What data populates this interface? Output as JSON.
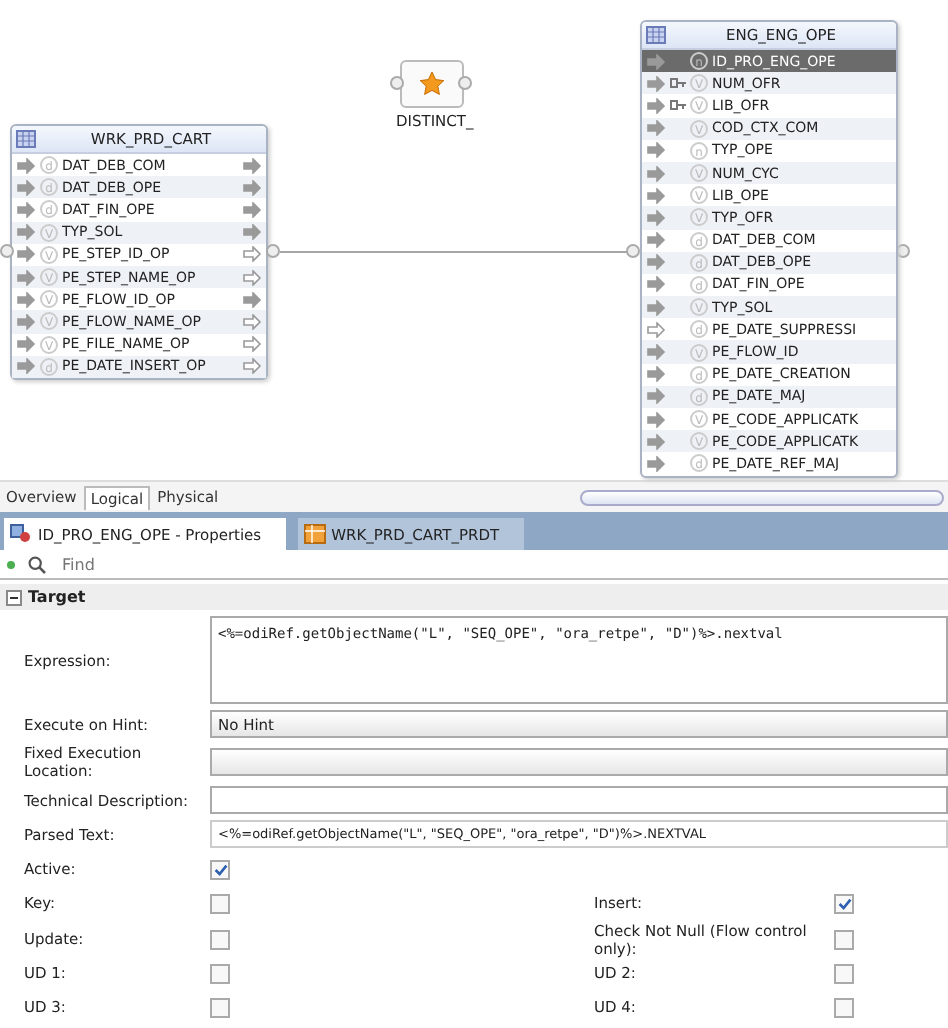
{
  "diagram": {
    "distinct": {
      "label": "DISTINCT_"
    },
    "source": {
      "title": "WRK_PRD_CART",
      "columns": [
        {
          "name": "DAT_DEB_COM",
          "datatype": "d",
          "mapped": true
        },
        {
          "name": "DAT_DEB_OPE",
          "datatype": "d",
          "mapped": true
        },
        {
          "name": "DAT_FIN_OPE",
          "datatype": "d",
          "mapped": true
        },
        {
          "name": "TYP_SOL",
          "datatype": "V",
          "mapped": true
        },
        {
          "name": "PE_STEP_ID_OP",
          "datatype": "V",
          "mapped": false
        },
        {
          "name": "PE_STEP_NAME_OP",
          "datatype": "V",
          "mapped": false
        },
        {
          "name": "PE_FLOW_ID_OP",
          "datatype": "V",
          "mapped": true
        },
        {
          "name": "PE_FLOW_NAME_OP",
          "datatype": "V",
          "mapped": false
        },
        {
          "name": "PE_FILE_NAME_OP",
          "datatype": "V",
          "mapped": false
        },
        {
          "name": "PE_DATE_INSERT_OP",
          "datatype": "d",
          "mapped": false
        }
      ]
    },
    "target": {
      "title": "ENG_ENG_OPE",
      "columns": [
        {
          "name": "ID_PRO_ENG_OPE",
          "datatype": "n",
          "mapped": true,
          "key": false,
          "selected": true
        },
        {
          "name": "NUM_OFR",
          "datatype": "V",
          "mapped": true,
          "key": true,
          "selected": false
        },
        {
          "name": "LIB_OFR",
          "datatype": "V",
          "mapped": true,
          "key": true,
          "selected": false
        },
        {
          "name": "COD_CTX_COM",
          "datatype": "V",
          "mapped": true,
          "key": false,
          "selected": false
        },
        {
          "name": "TYP_OPE",
          "datatype": "n",
          "mapped": true,
          "key": false,
          "selected": false
        },
        {
          "name": "NUM_CYC",
          "datatype": "V",
          "mapped": true,
          "key": false,
          "selected": false
        },
        {
          "name": "LIB_OPE",
          "datatype": "V",
          "mapped": true,
          "key": false,
          "selected": false
        },
        {
          "name": "TYP_OFR",
          "datatype": "V",
          "mapped": true,
          "key": false,
          "selected": false
        },
        {
          "name": "DAT_DEB_COM",
          "datatype": "d",
          "mapped": true,
          "key": false,
          "selected": false
        },
        {
          "name": "DAT_DEB_OPE",
          "datatype": "d",
          "mapped": true,
          "key": false,
          "selected": false
        },
        {
          "name": "DAT_FIN_OPE",
          "datatype": "d",
          "mapped": true,
          "key": false,
          "selected": false
        },
        {
          "name": "TYP_SOL",
          "datatype": "V",
          "mapped": true,
          "key": false,
          "selected": false
        },
        {
          "name": "PE_DATE_SUPPRESSI",
          "datatype": "d",
          "mapped": false,
          "key": false,
          "selected": false
        },
        {
          "name": "PE_FLOW_ID",
          "datatype": "V",
          "mapped": true,
          "key": false,
          "selected": false
        },
        {
          "name": "PE_DATE_CREATION",
          "datatype": "d",
          "mapped": true,
          "key": false,
          "selected": false
        },
        {
          "name": "PE_DATE_MAJ",
          "datatype": "d",
          "mapped": true,
          "key": false,
          "selected": false
        },
        {
          "name": "PE_CODE_APPLICATK",
          "datatype": "V",
          "mapped": true,
          "key": false,
          "selected": false
        },
        {
          "name": "PE_CODE_APPLICATK",
          "datatype": "V",
          "mapped": true,
          "key": false,
          "selected": false
        },
        {
          "name": "PE_DATE_REF_MAJ",
          "datatype": "d",
          "mapped": true,
          "key": false,
          "selected": false
        }
      ]
    }
  },
  "view_tabs": [
    {
      "label": "Overview",
      "selected": false
    },
    {
      "label": "Logical",
      "selected": true
    },
    {
      "label": "Physical",
      "selected": false
    }
  ],
  "editor_tabs": [
    {
      "label": "ID_PRO_ENG_OPE - Properties",
      "selected": true
    },
    {
      "label": "WRK_PRD_CART_PRDT",
      "selected": false
    }
  ],
  "search": {
    "placeholder": "Find"
  },
  "section": {
    "title": "Target",
    "expanded": true
  },
  "fields": [
    {
      "kind": "textarea",
      "label": "Expression:",
      "value": "<%=odiRef.getObjectName(\"L\", \"SEQ_OPE\", \"ora_retpe\", \"D\")%>.nextval"
    },
    {
      "kind": "dropdown",
      "label": "Execute on Hint:",
      "value": "No Hint"
    },
    {
      "kind": "dropdown",
      "label": "Fixed Execution Location:"
    },
    {
      "kind": "text",
      "label": "Technical Description:"
    },
    {
      "kind": "readonly",
      "label": "Parsed Text:",
      "value": "<%=odiRef.getObjectName(\"L\", \"SEQ_OPE\", \"ora_retpe\", \"D\")%>.NEXTVAL"
    }
  ],
  "active": {
    "label": "Active:",
    "checked": true
  },
  "options": [
    [
      {
        "label": "Key:",
        "checked": false
      },
      {
        "label": "Insert:",
        "checked": true
      }
    ],
    [
      {
        "label": "Update:",
        "checked": false
      },
      {
        "label": "Check Not Null (Flow control only):",
        "checked": false
      }
    ],
    [
      {
        "label": "UD 1:",
        "checked": false
      },
      {
        "label": "UD 2:",
        "checked": false
      }
    ],
    [
      {
        "label": "UD 3:",
        "checked": false
      },
      {
        "label": "UD 4:",
        "checked": false
      }
    ]
  ]
}
